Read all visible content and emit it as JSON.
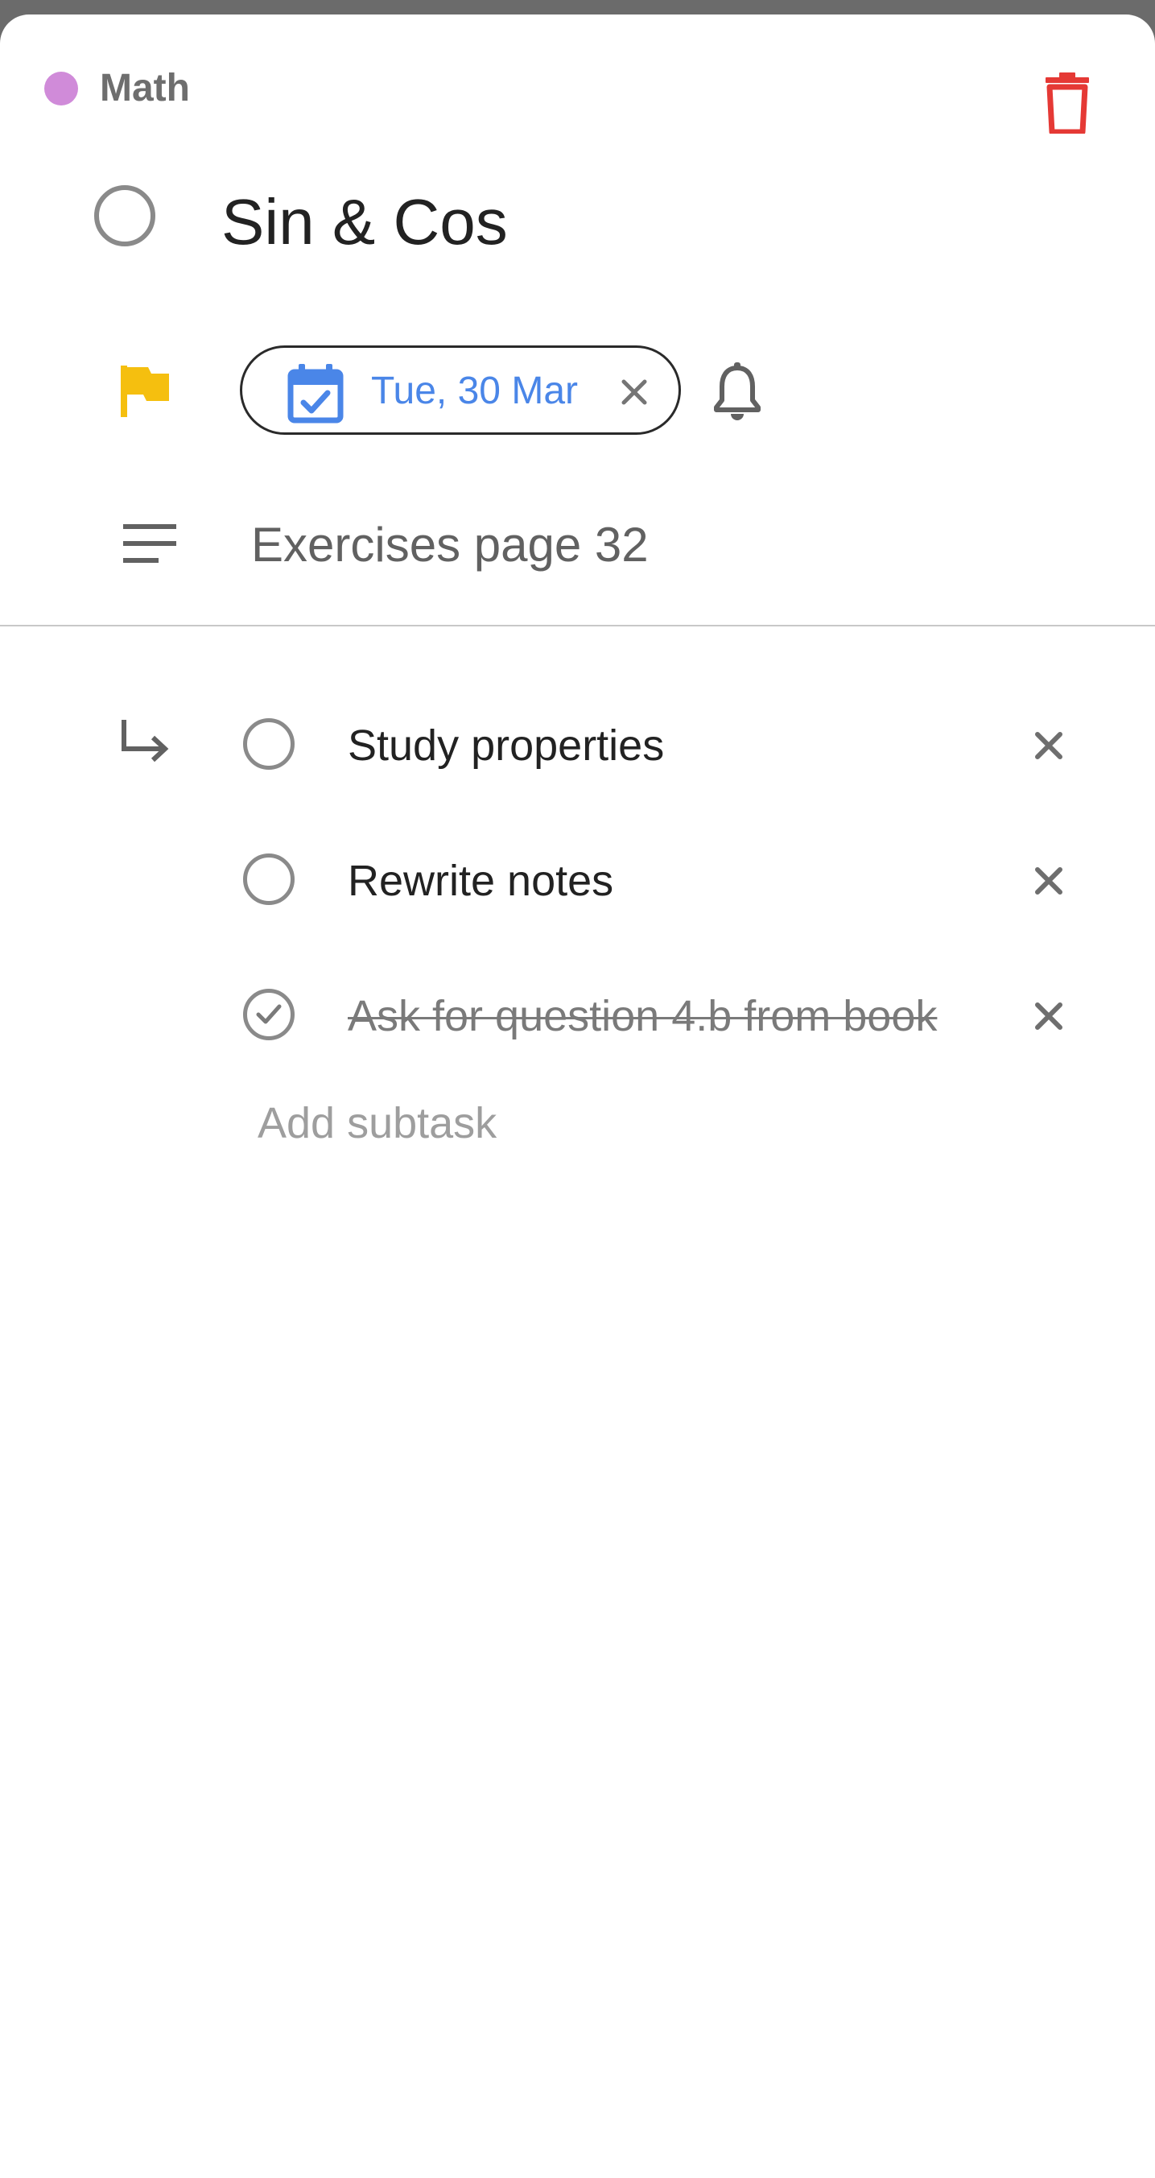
{
  "list": {
    "name": "Math",
    "color": "#d08bd9"
  },
  "task": {
    "title": "Sin & Cos",
    "priority_flag_color": "#f5bf0f",
    "due_date": "Tue, 30 Mar",
    "due_date_color": "#4a86e8",
    "notes": "Exercises page 32"
  },
  "subtasks": [
    {
      "label": "Study properties",
      "completed": false
    },
    {
      "label": "Rewrite notes",
      "completed": false
    },
    {
      "label": "Ask for question 4.b from book",
      "completed": true
    }
  ],
  "add_subtask_placeholder": "Add subtask",
  "colors": {
    "delete": "#e53935",
    "icon_gray": "#616161"
  },
  "icons": {
    "delete": "trash-icon",
    "priority": "flag-icon",
    "due_date": "calendar-icon",
    "clear_date": "close-icon",
    "reminder": "bell-icon",
    "notes": "notes-icon",
    "subtasks": "subtask-arrow-icon",
    "remove_subtask": "close-icon"
  }
}
